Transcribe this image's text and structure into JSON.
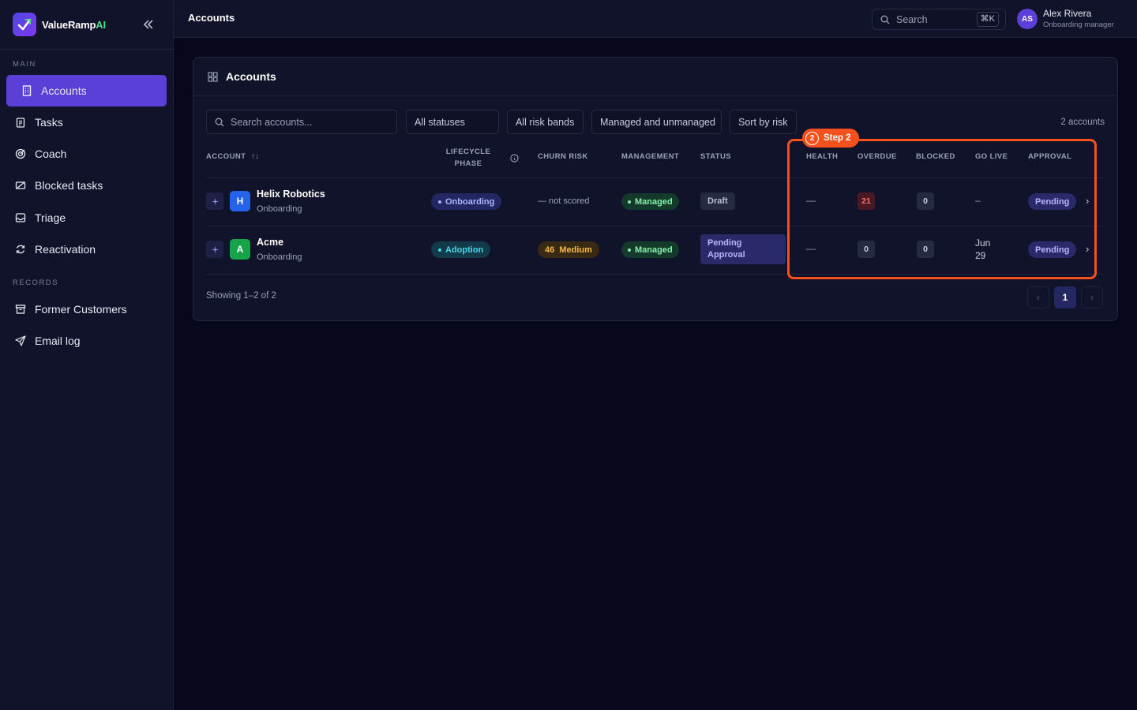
{
  "brand": {
    "name_main": "ValueRamp",
    "name_accent": "AI"
  },
  "sidebar": {
    "section_main": "MAIN",
    "section_records": "RECORDS",
    "main_items": [
      {
        "label": "Accounts",
        "icon": "building-icon",
        "active": true
      },
      {
        "label": "Tasks",
        "icon": "clipboard-icon"
      },
      {
        "label": "Coach",
        "icon": "target-icon"
      },
      {
        "label": "Blocked tasks",
        "icon": "blocked-icon"
      },
      {
        "label": "Triage",
        "icon": "inbox-icon"
      },
      {
        "label": "Reactivation",
        "icon": "refresh-icon"
      }
    ],
    "record_items": [
      {
        "label": "Former Customers",
        "icon": "archive-icon"
      },
      {
        "label": "Email log",
        "icon": "send-icon"
      }
    ]
  },
  "topbar": {
    "title": "Accounts",
    "search_label": "Search",
    "search_shortcut": "⌘K",
    "user": {
      "initials": "AS",
      "name": "Alex Rivera",
      "role": "Onboarding manager"
    }
  },
  "card": {
    "title": "Accounts",
    "search_placeholder": "Search accounts...",
    "filters": [
      "All statuses",
      "All risk bands",
      "Managed and unmanaged",
      "Sort by risk"
    ],
    "count_label": "2 accounts",
    "columns": {
      "account": "ACCOUNT",
      "sort_glyph": "↑↓",
      "lifecycle_line1": "LIFECYCLE",
      "lifecycle_line2": "PHASE",
      "churn_risk": "CHURN RISK",
      "management": "MANAGEMENT",
      "status": "STATUS",
      "health": "HEALTH",
      "overdue": "OVERDUE",
      "blocked": "BLOCKED",
      "go_live": "GO LIVE",
      "approval": "APPROVAL"
    },
    "rows": [
      {
        "initial": "H",
        "avatar_color": "#2563eb",
        "name": "Helix Robotics",
        "sub": "Onboarding",
        "lifecycle": "Onboarding",
        "churn": "— not scored",
        "management": "Managed",
        "status": "Draft",
        "health": "—",
        "overdue": "21",
        "blocked": "0",
        "go_live": "–",
        "approval": "Pending"
      },
      {
        "initial": "A",
        "avatar_color": "#16a34a",
        "name": "Acme",
        "sub": "Onboarding",
        "lifecycle": "Adoption",
        "churn_score": "46",
        "churn_band": "Medium",
        "management": "Managed",
        "status_line1": "Pending",
        "status_line2": "Approval",
        "health": "—",
        "overdue": "0",
        "blocked": "0",
        "go_live_line1": "Jun",
        "go_live_line2": "29",
        "approval": "Pending"
      }
    ],
    "showing": "Showing 1–2 of 2",
    "page_current": "1"
  },
  "overlay": {
    "step_number": "2",
    "step_label": "Step 2",
    "color": "#f4511e"
  },
  "colors": {
    "accent": "#5b3fd6",
    "background": "#08081c",
    "panel": "#11132a"
  }
}
